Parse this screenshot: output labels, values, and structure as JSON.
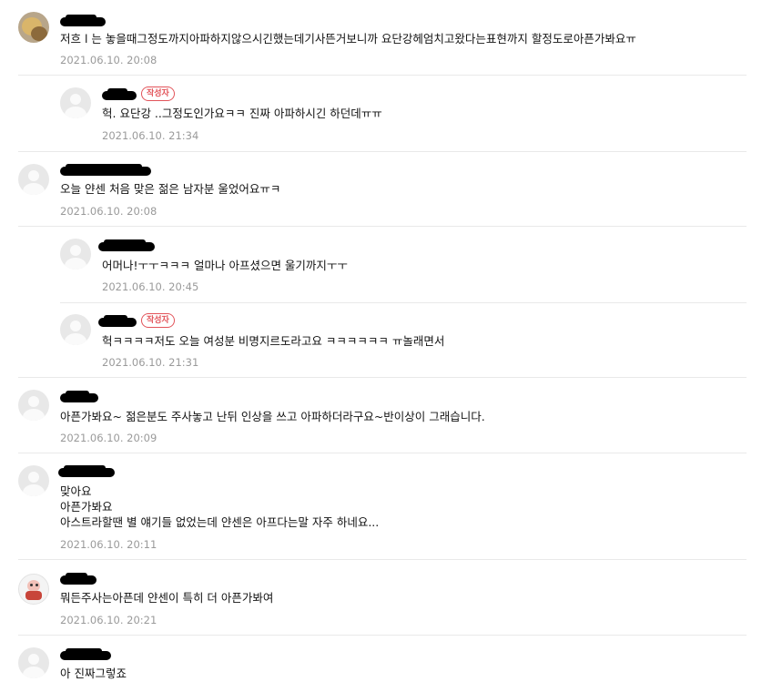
{
  "author_badge": "작성자",
  "comments": [
    {
      "text": "저흐 l 는 놓을때그정도까지아파하지않으시긴했는데기사뜬거보니까 요단강헤엄치고왔다는표현까지 할정도로아픈가봐요ㅠ",
      "date": "2021.06.10. 20:08",
      "replies": [
        {
          "author": true,
          "text": "헉. 요단강 ..그정도인가요ㅋㅋ 진짜 아파하시긴 하던데ㅠㅠ",
          "date": "2021.06.10. 21:34"
        }
      ]
    },
    {
      "text": "오늘 얀센 처음 맞은 젊은 남자분 울었어요ㅠㅋ",
      "date": "2021.06.10. 20:08",
      "replies": [
        {
          "author": false,
          "text": "어머나!ㅜㅜㅋㅋㅋ 얼마나 아프셨으면 울기까지ㅜㅜ",
          "date": "2021.06.10. 20:45"
        },
        {
          "author": true,
          "text": "헉ㅋㅋㅋㅋ저도 오늘 여성분 비명지르도라고요 ㅋㅋㅋㅋㅋㅋ ㅠ놀래면서",
          "date": "2021.06.10. 21:31"
        }
      ]
    },
    {
      "text": "아픈가봐요~ 젊은분도 주사놓고 난뒤 인상을 쓰고 아파하더라구요~반이상이 그래습니다.",
      "date": "2021.06.10. 20:09",
      "replies": []
    },
    {
      "lines": [
        "맞아요",
        "아픈가봐요",
        "아스트라할땐 별 얘기들 없었는데 얀센은 아프다는말 자주 하네요..."
      ],
      "date": "2021.06.10. 20:11",
      "replies": []
    },
    {
      "text": "뭐든주사는아픈데 얀센이 특히 더 아픈가봐여",
      "date": "2021.06.10. 20:21",
      "replies": []
    },
    {
      "text": "아 진짜그렇죠",
      "replies": []
    }
  ]
}
